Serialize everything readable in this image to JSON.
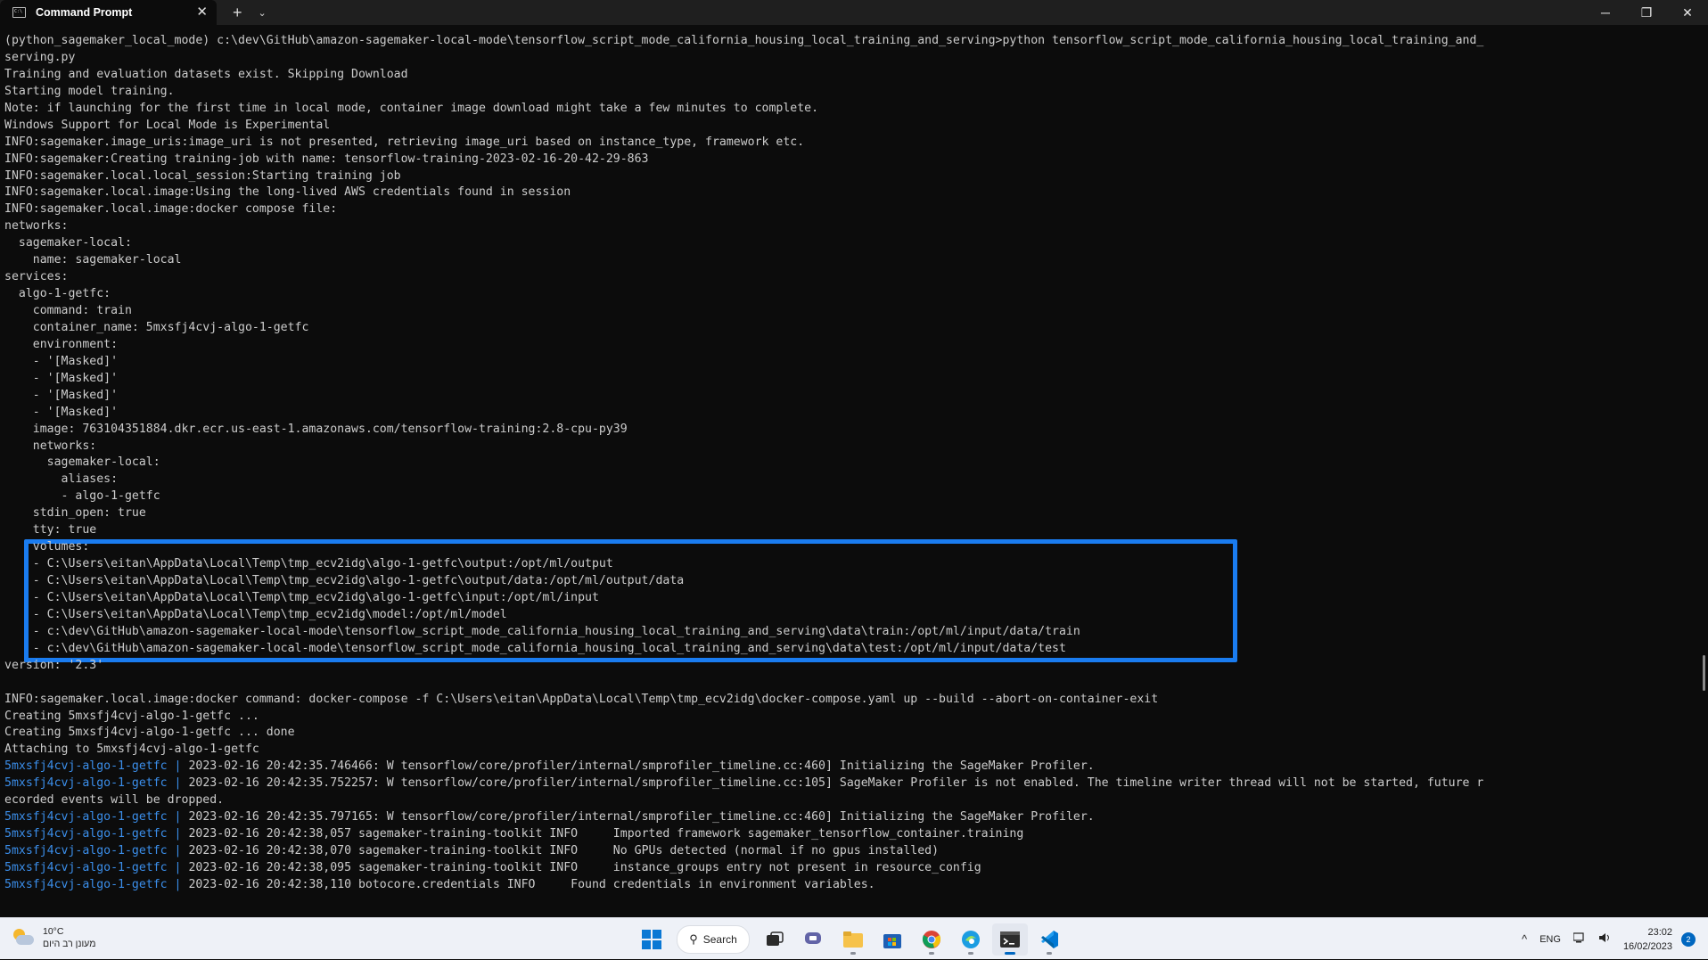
{
  "window": {
    "tab_title": "Command Prompt",
    "close_tab_glyph": "✕",
    "new_tab_glyph": "+",
    "dropdown_glyph": "⌄",
    "minimize_glyph": "─",
    "maximize_glyph": "❐",
    "close_glyph": "✕"
  },
  "console": {
    "lines_top": [
      "(python_sagemaker_local_mode) c:\\dev\\GitHub\\amazon-sagemaker-local-mode\\tensorflow_script_mode_california_housing_local_training_and_serving>python tensorflow_script_mode_california_housing_local_training_and_",
      "serving.py",
      "Training and evaluation datasets exist. Skipping Download",
      "Starting model training.",
      "Note: if launching for the first time in local mode, container image download might take a few minutes to complete.",
      "Windows Support for Local Mode is Experimental",
      "INFO:sagemaker.image_uris:image_uri is not presented, retrieving image_uri based on instance_type, framework etc.",
      "INFO:sagemaker:Creating training-job with name: tensorflow-training-2023-02-16-20-42-29-863",
      "INFO:sagemaker.local.local_session:Starting training job",
      "INFO:sagemaker.local.image:Using the long-lived AWS credentials found in session",
      "INFO:sagemaker.local.image:docker compose file:",
      "networks:",
      "  sagemaker-local:",
      "    name: sagemaker-local",
      "services:",
      "  algo-1-getfc:",
      "    command: train",
      "    container_name: 5mxsfj4cvj-algo-1-getfc",
      "    environment:",
      "    - '[Masked]'",
      "    - '[Masked]'",
      "    - '[Masked]'",
      "    - '[Masked]'",
      "    image: 763104351884.dkr.ecr.us-east-1.amazonaws.com/tensorflow-training:2.8-cpu-py39",
      "    networks:",
      "      sagemaker-local:",
      "        aliases:",
      "        - algo-1-getfc",
      "    stdin_open: true",
      "    tty: true"
    ],
    "volumes_lines": [
      "    volumes:",
      "    - C:\\Users\\eitan\\AppData\\Local\\Temp\\tmp_ecv2idg\\algo-1-getfc\\output:/opt/ml/output",
      "    - C:\\Users\\eitan\\AppData\\Local\\Temp\\tmp_ecv2idg\\algo-1-getfc\\output/data:/opt/ml/output/data",
      "    - C:\\Users\\eitan\\AppData\\Local\\Temp\\tmp_ecv2idg\\algo-1-getfc\\input:/opt/ml/input",
      "    - C:\\Users\\eitan\\AppData\\Local\\Temp\\tmp_ecv2idg\\model:/opt/ml/model",
      "    - c:\\dev\\GitHub\\amazon-sagemaker-local-mode\\tensorflow_script_mode_california_housing_local_training_and_serving\\data\\train:/opt/ml/input/data/train",
      "    - c:\\dev\\GitHub\\amazon-sagemaker-local-mode\\tensorflow_script_mode_california_housing_local_training_and_serving\\data\\test:/opt/ml/input/data/test"
    ],
    "lines_after": [
      "version: '2.3'",
      "",
      "INFO:sagemaker.local.image:docker command: docker-compose -f C:\\Users\\eitan\\AppData\\Local\\Temp\\tmp_ecv2idg\\docker-compose.yaml up --build --abort-on-container-exit",
      "Creating 5mxsfj4cvj-algo-1-getfc ...",
      "Creating 5mxsfj4cvj-algo-1-getfc ... done",
      "Attaching to 5mxsfj4cvj-algo-1-getfc"
    ],
    "container_prefix": "5mxsfj4cvj-algo-1-getfc |",
    "log_lines": [
      " 2023-02-16 20:42:35.746466: W tensorflow/core/profiler/internal/smprofiler_timeline.cc:460] Initializing the SageMaker Profiler.",
      " 2023-02-16 20:42:35.752257: W tensorflow/core/profiler/internal/smprofiler_timeline.cc:105] SageMaker Profiler is not enabled. The timeline writer thread will not be started, future r",
      "ecorded events will be dropped.",
      " 2023-02-16 20:42:35.797165: W tensorflow/core/profiler/internal/smprofiler_timeline.cc:460] Initializing the SageMaker Profiler.",
      " 2023-02-16 20:42:38,057 sagemaker-training-toolkit INFO     Imported framework sagemaker_tensorflow_container.training",
      " 2023-02-16 20:42:38,070 sagemaker-training-toolkit INFO     No GPUs detected (normal if no gpus installed)",
      " 2023-02-16 20:42:38,095 sagemaker-training-toolkit INFO     instance_groups entry not present in resource_config",
      " 2023-02-16 20:42:38,110 botocore.credentials INFO     Found credentials in environment variables."
    ]
  },
  "taskbar": {
    "weather_temp": "10°C",
    "weather_desc": "מעונן רב היום",
    "search_label": "Search",
    "language": "ENG",
    "time": "23:02",
    "date": "16/02/2023",
    "notification_count": "2",
    "tray_up_glyph": "^"
  },
  "colors": {
    "console_bg": "#0c0c0c",
    "console_text": "#cccccc",
    "prefix_blue": "#3b8eea",
    "highlight_border": "#1a7cf0"
  }
}
